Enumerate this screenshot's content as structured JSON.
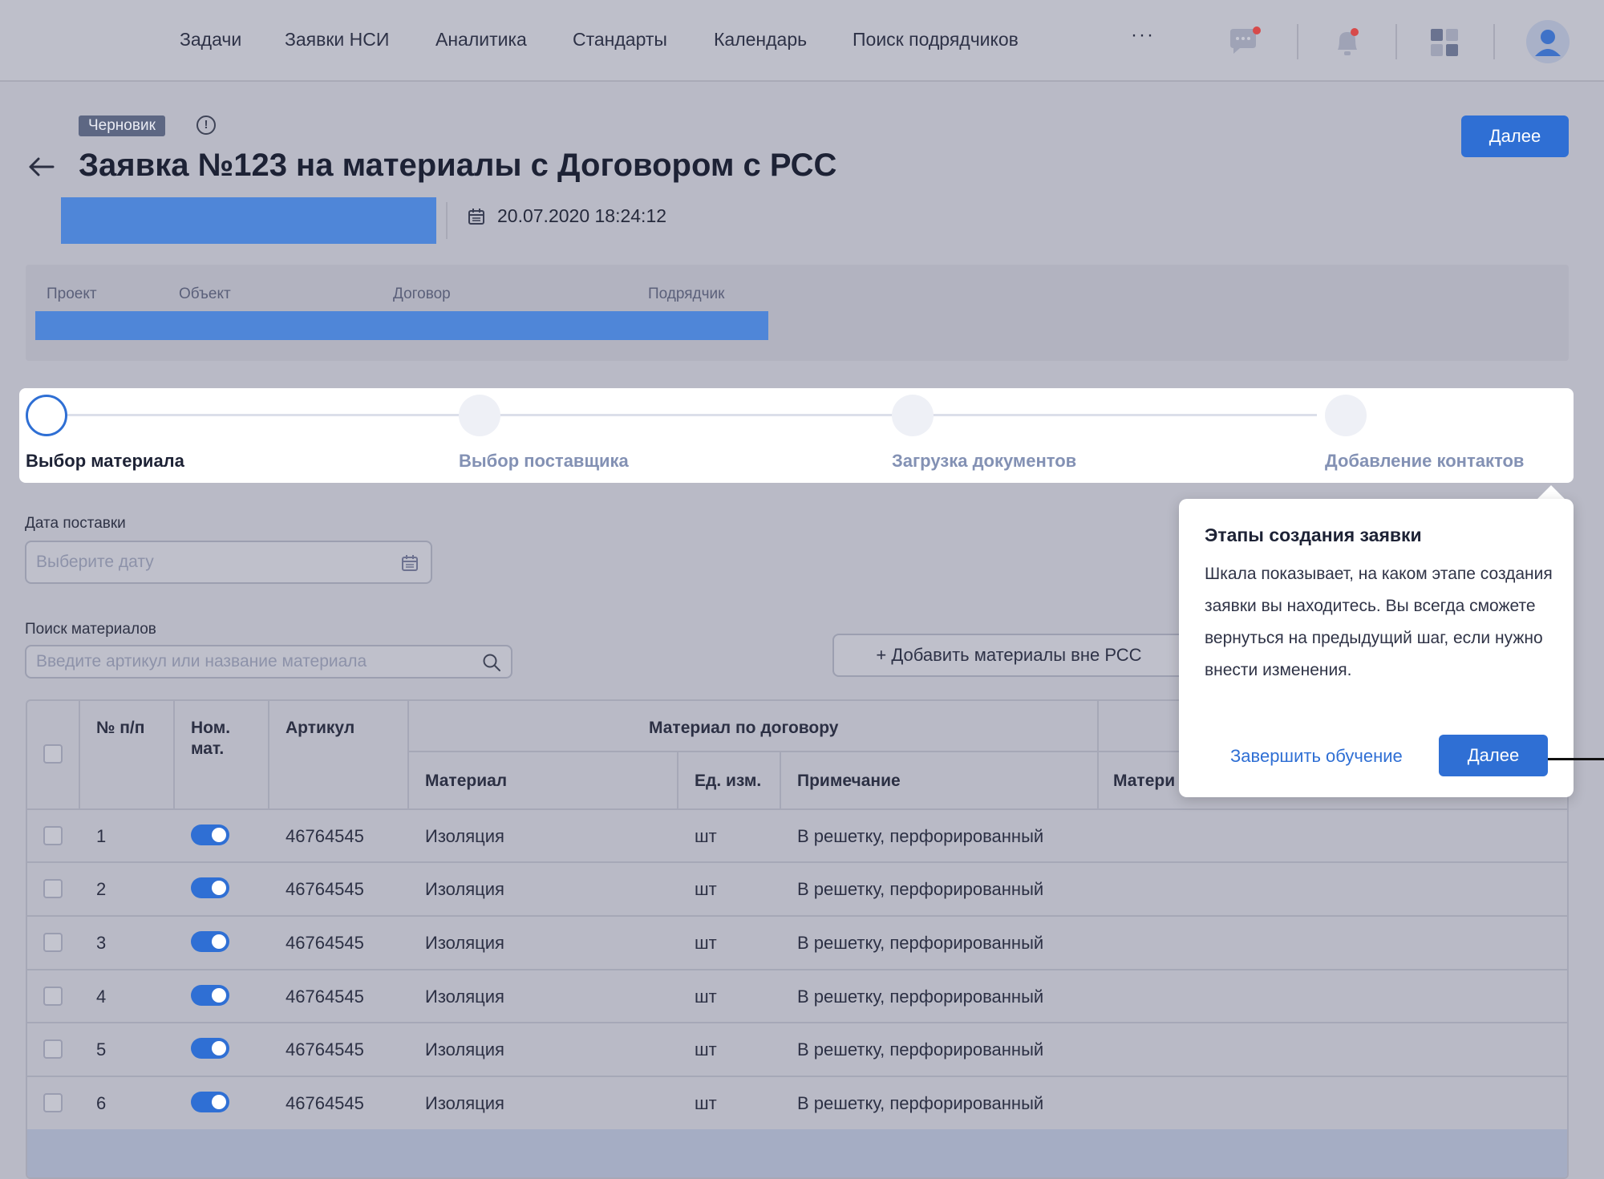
{
  "nav": {
    "items": [
      "Задачи",
      "Заявки НСИ",
      "Аналитика",
      "Стандарты",
      "Календарь",
      "Поиск подрядчиков"
    ],
    "more": "···"
  },
  "header": {
    "badge": "Черновик",
    "info_icon": "!",
    "title": "Заявка №123 на материалы с Договором с РСС",
    "next_button": "Далее",
    "datetime": "20.07.2020 18:24:12"
  },
  "info_panel": {
    "labels": [
      "Проект",
      "Объект",
      "Договор",
      "Подрядчик"
    ]
  },
  "stepper": {
    "steps": [
      "Выбор материала",
      "Выбор поставщика",
      "Загрузка документов",
      "Добавление контактов"
    ],
    "active_index": 0
  },
  "form": {
    "delivery_label": "Дата поставки",
    "delivery_placeholder": "Выберите дату",
    "search_label": "Поиск материалов",
    "search_placeholder": "Введите артикул или название материала",
    "add_outside_button": "+ Добавить материалы вне РСС"
  },
  "table": {
    "headers": {
      "num": "№ п/п",
      "nom_line1": "Ном.",
      "nom_line2": "мат.",
      "article": "Артикул",
      "group": "Материал по договору",
      "material": "Материал",
      "unit": "Ед. изм.",
      "note": "Примечание",
      "material_clipped": "Матери"
    },
    "rows": [
      {
        "n": "1",
        "article": "46764545",
        "material": "Изоляция",
        "unit": "шт",
        "note": "В решетку, перфорированный",
        "nom": true
      },
      {
        "n": "2",
        "article": "46764545",
        "material": "Изоляция",
        "unit": "шт",
        "note": "В решетку, перфорированный",
        "nom": true
      },
      {
        "n": "3",
        "article": "46764545",
        "material": "Изоляция",
        "unit": "шт",
        "note": "В решетку, перфорированный",
        "nom": true
      },
      {
        "n": "4",
        "article": "46764545",
        "material": "Изоляция",
        "unit": "шт",
        "note": "В решетку, перфорированный",
        "nom": true
      },
      {
        "n": "5",
        "article": "46764545",
        "material": "Изоляция",
        "unit": "шт",
        "note": "В решетку, перфорированный",
        "nom": true
      },
      {
        "n": "6",
        "article": "46764545",
        "material": "Изоляция",
        "unit": "шт",
        "note": "В решетку, перфорированный",
        "nom": true
      }
    ]
  },
  "tooltip": {
    "title": "Этапы создания заявки",
    "body": "Шкала показывает, на каком этапе создания заявки вы находитесь. Вы всегда сможете вернуться на предыдущий шаг, если нужно внести изменения.",
    "finish_link": "Завершить обучение",
    "next_button": "Далее"
  },
  "colors": {
    "accent": "#2f6fd4",
    "overlay_bg": "#b9bac6",
    "redacted": "#4f86d8"
  },
  "icons": [
    "chat-icon",
    "bell-icon",
    "apps-grid-icon",
    "user-avatar-icon",
    "back-arrow-icon",
    "calendar-icon",
    "search-icon",
    "info-icon"
  ]
}
